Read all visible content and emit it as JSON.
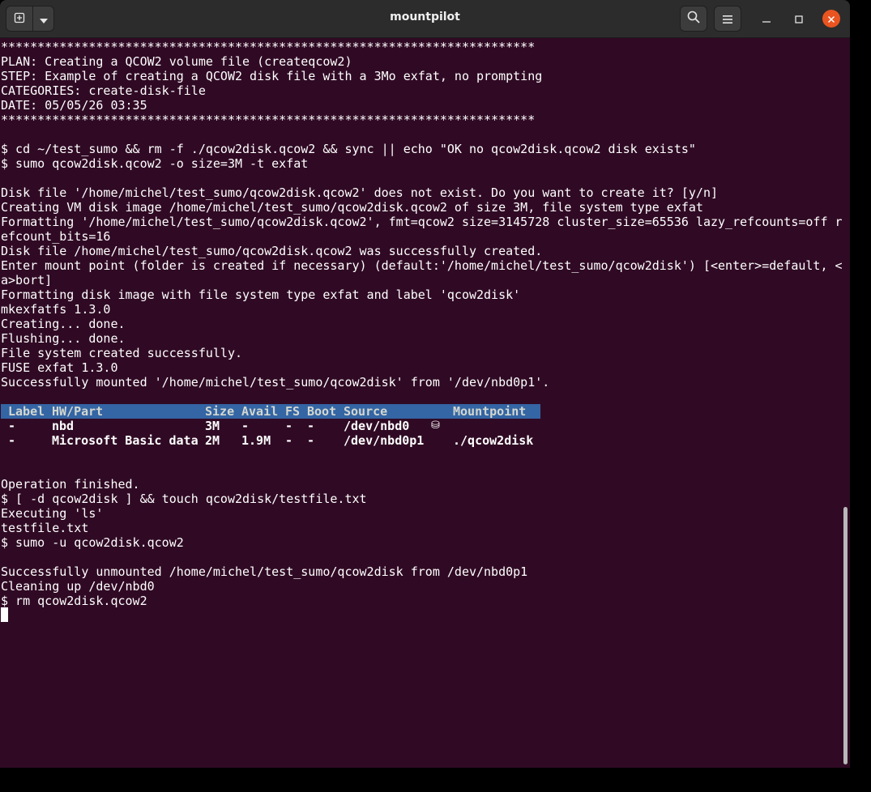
{
  "window": {
    "title": "mountpilot"
  },
  "icons": {
    "new_tab": "new-tab-icon",
    "tab_menu": "chevron-down-icon",
    "search": "search-icon",
    "menu": "hamburger-menu-icon",
    "minimize": "minimize-icon",
    "maximize": "maximize-icon",
    "close": "close-icon"
  },
  "colors": {
    "terminal_bg": "#300a24",
    "titlebar_bg": "#2c2c2c",
    "table_header_bg": "#3465a4",
    "close_accent": "#e95420"
  },
  "terminal": {
    "lines_top": [
      "*************************************************************************",
      "PLAN: Creating a QCOW2 volume file (createqcow2)",
      "STEP: Example of creating a QCOW2 disk file with a 3Mo exfat, no prompting",
      "CATEGORIES: create-disk-file",
      "DATE: 05/05/26 03:35",
      "*************************************************************************",
      "",
      "$ cd ~/test_sumo && rm -f ./qcow2disk.qcow2 && sync || echo \"OK no qcow2disk.qcow2 disk exists\"",
      "$ sumo qcow2disk.qcow2 -o size=3M -t exfat",
      "",
      "Disk file '/home/michel/test_sumo/qcow2disk.qcow2' does not exist. Do you want to create it? [y/n]",
      "Creating VM disk image /home/michel/test_sumo/qcow2disk.qcow2 of size 3M, file system type exfat",
      "Formatting '/home/michel/test_sumo/qcow2disk.qcow2', fmt=qcow2 size=3145728 cluster_size=65536 lazy_refcounts=off r",
      "efcount_bits=16",
      "Disk file /home/michel/test_sumo/qcow2disk.qcow2 was successfully created.",
      "Enter mount point (folder is created if necessary) (default:'/home/michel/test_sumo/qcow2disk') [<enter>=default, <",
      "a>bort]",
      "Formatting disk image with file system type exfat and label 'qcow2disk'",
      "mkexfatfs 1.3.0",
      "Creating... done.",
      "Flushing... done.",
      "File system created successfully.",
      "FUSE exfat 1.3.0",
      "Successfully mounted '/home/michel/test_sumo/qcow2disk' from '/dev/nbd0p1'."
    ],
    "table": {
      "headers": [
        "Label",
        "HW/Part",
        "Size",
        "Avail",
        "FS",
        "Boot",
        "Source",
        "Mountpoint"
      ],
      "rows": [
        [
          "-",
          "nbd",
          "3M",
          "-",
          "-",
          "-",
          "/dev/nbd0",
          ""
        ],
        [
          "-",
          "Microsoft Basic data",
          "2M",
          "1.9M",
          "-",
          "-",
          "/dev/nbd0p1",
          "./qcow2disk"
        ]
      ],
      "disk_glyph": "⛁"
    },
    "lines_bottom": [
      "Operation finished.",
      "$ [ -d qcow2disk ] && touch qcow2disk/testfile.txt",
      "Executing 'ls'",
      "testfile.txt",
      "$ sumo -u qcow2disk.qcow2",
      "",
      "Successfully unmounted /home/michel/test_sumo/qcow2disk from /dev/nbd0p1",
      "Cleaning up /dev/nbd0",
      "$ rm qcow2disk.qcow2"
    ]
  }
}
